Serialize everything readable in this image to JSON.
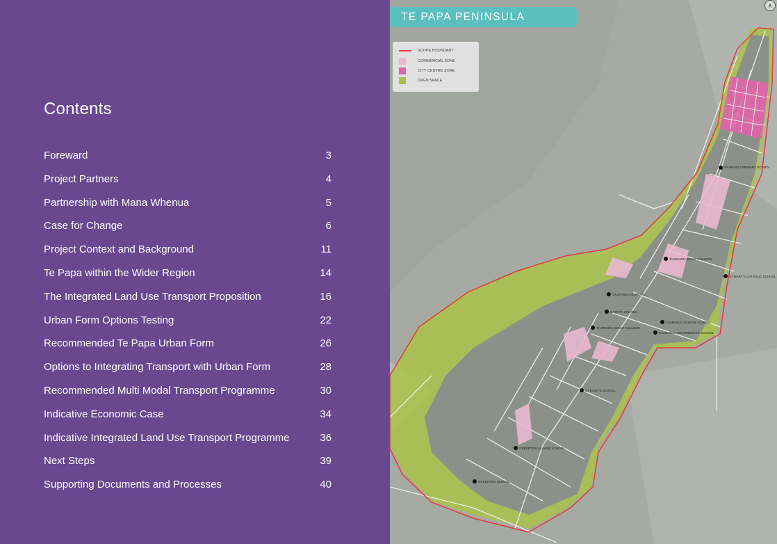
{
  "contents": {
    "title": "Contents",
    "items": [
      {
        "label": "Foreward",
        "page": "3"
      },
      {
        "label": "Project Partners",
        "page": "4"
      },
      {
        "label": "Partnership with Mana Whenua",
        "page": "5"
      },
      {
        "label": "Case for Change",
        "page": "6"
      },
      {
        "label": "Project Context and Background",
        "page": "11"
      },
      {
        "label": "Te Papa within the Wider Region",
        "page": "14"
      },
      {
        "label": "The Integrated Land Use Transport Proposition",
        "page": "16"
      },
      {
        "label": "Urban Form Options Testing",
        "page": "22"
      },
      {
        "label": "Recommended Te Papa Urban Form",
        "page": "26"
      },
      {
        "label": "Options to Integrating Transport with Urban Form",
        "page": "28"
      },
      {
        "label": "Recommended Multi Modal Transport Programme",
        "page": "30"
      },
      {
        "label": "Indicative Economic Case",
        "page": "34"
      },
      {
        "label": "Indicative Integrated Land Use Transport Programme",
        "page": "36"
      },
      {
        "label": "Next Steps",
        "page": "39"
      },
      {
        "label": "Supporting Documents and Processes",
        "page": "40"
      }
    ]
  },
  "map": {
    "title": "TE PAPA PENINSULA",
    "north_icon": "north-arrow-icon",
    "legend": [
      {
        "label": "SCOPE BOUNDARY",
        "color": "#e23b3b",
        "kind": "line"
      },
      {
        "label": "COMMERCIAL ZONE",
        "color": "#e9b9d0",
        "kind": "swatch"
      },
      {
        "label": "CITY CENTRE ZONE",
        "color": "#e065a8",
        "kind": "swatch"
      },
      {
        "label": "OPEN SPACE",
        "color": "#a9c24a",
        "kind": "swatch"
      }
    ],
    "schools": [
      "TAURANGA PRIMARY SCHOOL",
      "TAURANGA BOYS' COLLEGE",
      "ST MARY'S CATHOLIC SCHOOL",
      "TAURANGA HOSPITAL",
      "GATE PA SCHOOL",
      "TAURANGA GIRLS' COLLEGE",
      "TAURANGA SCHOOL SCHOOL",
      "TAURANGA INTERMEDIATE SCHOOL",
      "ST MARY'S SCHOOL",
      "GREERTON VILLAGE SCHOOL",
      "GREERTON SCHOOL"
    ]
  },
  "colors": {
    "panel": "#694890",
    "tab": "#5bbfbe",
    "boundary": "#e23b3b",
    "commercial": "#e9b9d0",
    "city_centre": "#e065a8",
    "open_space": "#a9c24a"
  }
}
